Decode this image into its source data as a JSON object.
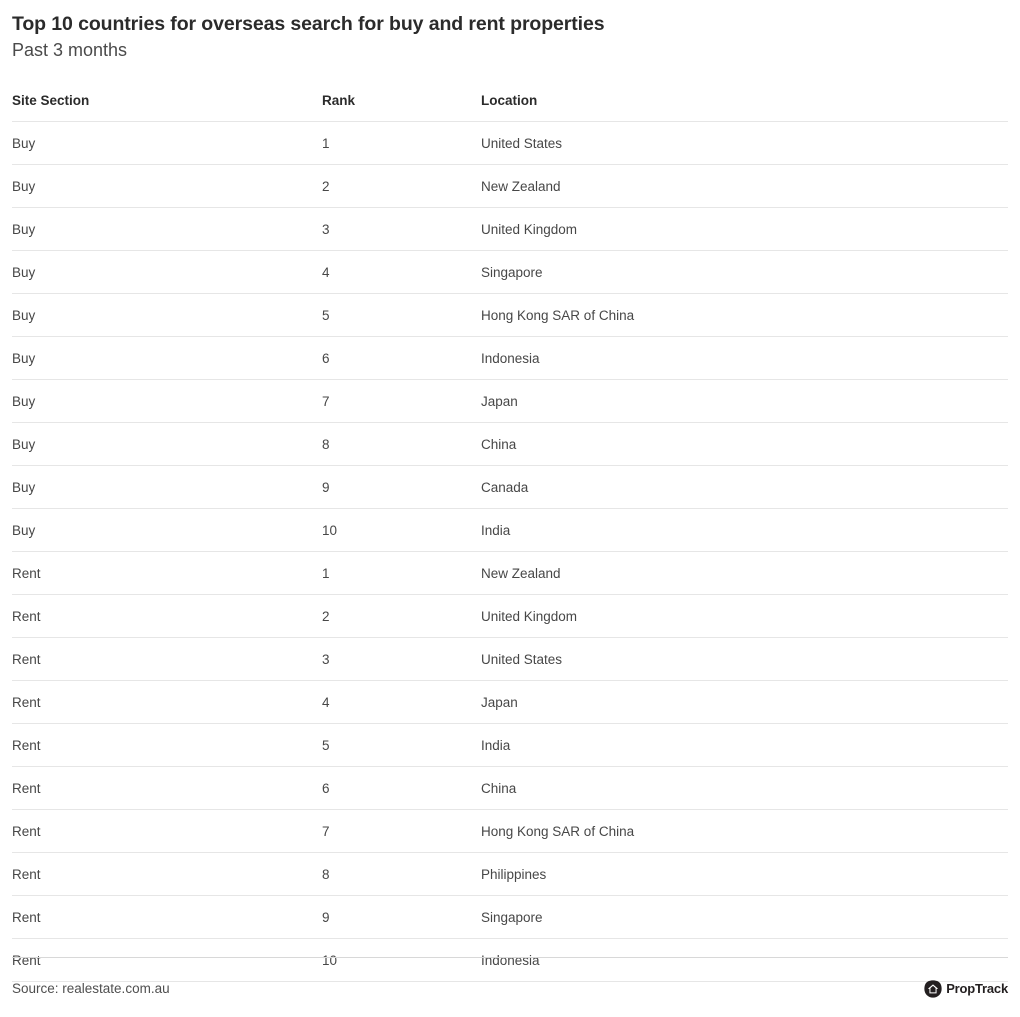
{
  "header": {
    "title": "Top 10 countries for overseas search for buy and rent properties",
    "subtitle": "Past 3 months"
  },
  "table": {
    "columns": [
      {
        "key": "site_section",
        "label": "Site Section"
      },
      {
        "key": "rank",
        "label": "Rank"
      },
      {
        "key": "location",
        "label": "Location"
      }
    ],
    "rows": [
      {
        "site_section": "Buy",
        "rank": "1",
        "location": "United States"
      },
      {
        "site_section": "Buy",
        "rank": "2",
        "location": "New Zealand"
      },
      {
        "site_section": "Buy",
        "rank": "3",
        "location": "United Kingdom"
      },
      {
        "site_section": "Buy",
        "rank": "4",
        "location": "Singapore"
      },
      {
        "site_section": "Buy",
        "rank": "5",
        "location": "Hong Kong SAR of China"
      },
      {
        "site_section": "Buy",
        "rank": "6",
        "location": "Indonesia"
      },
      {
        "site_section": "Buy",
        "rank": "7",
        "location": "Japan"
      },
      {
        "site_section": "Buy",
        "rank": "8",
        "location": "China"
      },
      {
        "site_section": "Buy",
        "rank": "9",
        "location": "Canada"
      },
      {
        "site_section": "Buy",
        "rank": "10",
        "location": "India"
      },
      {
        "site_section": "Rent",
        "rank": "1",
        "location": "New Zealand"
      },
      {
        "site_section": "Rent",
        "rank": "2",
        "location": "United Kingdom"
      },
      {
        "site_section": "Rent",
        "rank": "3",
        "location": "United States"
      },
      {
        "site_section": "Rent",
        "rank": "4",
        "location": "Japan"
      },
      {
        "site_section": "Rent",
        "rank": "5",
        "location": "India"
      },
      {
        "site_section": "Rent",
        "rank": "6",
        "location": "China"
      },
      {
        "site_section": "Rent",
        "rank": "7",
        "location": "Hong Kong SAR of China"
      },
      {
        "site_section": "Rent",
        "rank": "8",
        "location": "Philippines"
      },
      {
        "site_section": "Rent",
        "rank": "9",
        "location": "Singapore"
      },
      {
        "site_section": "Rent",
        "rank": "10",
        "location": "Indonesia"
      }
    ]
  },
  "footer": {
    "source": "Source: realestate.com.au",
    "brand_name": "PropTrack",
    "brand_icon": "proptrack-house-logo-icon"
  },
  "colors": {
    "title": "#2b2b2b",
    "body_text": "#474747",
    "rule": "#e6e6e6",
    "brand": "#231f20",
    "background": "#ffffff"
  },
  "chart_data": {
    "type": "table",
    "title": "Top 10 countries for overseas search for buy and rent properties",
    "subtitle": "Past 3 months",
    "columns": [
      "Site Section",
      "Rank",
      "Location"
    ],
    "rows": [
      [
        "Buy",
        1,
        "United States"
      ],
      [
        "Buy",
        2,
        "New Zealand"
      ],
      [
        "Buy",
        3,
        "United Kingdom"
      ],
      [
        "Buy",
        4,
        "Singapore"
      ],
      [
        "Buy",
        5,
        "Hong Kong SAR of China"
      ],
      [
        "Buy",
        6,
        "Indonesia"
      ],
      [
        "Buy",
        7,
        "Japan"
      ],
      [
        "Buy",
        8,
        "China"
      ],
      [
        "Buy",
        9,
        "Canada"
      ],
      [
        "Buy",
        10,
        "India"
      ],
      [
        "Rent",
        1,
        "New Zealand"
      ],
      [
        "Rent",
        2,
        "United Kingdom"
      ],
      [
        "Rent",
        3,
        "United States"
      ],
      [
        "Rent",
        4,
        "Japan"
      ],
      [
        "Rent",
        5,
        "India"
      ],
      [
        "Rent",
        6,
        "China"
      ],
      [
        "Rent",
        7,
        "Hong Kong SAR of China"
      ],
      [
        "Rent",
        8,
        "Philippines"
      ],
      [
        "Rent",
        9,
        "Singapore"
      ],
      [
        "Rent",
        10,
        "Indonesia"
      ]
    ],
    "source": "Source: realestate.com.au"
  }
}
